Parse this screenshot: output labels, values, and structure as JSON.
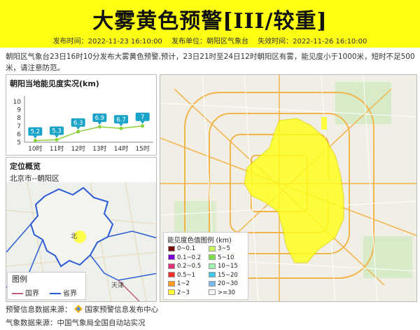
{
  "header": {
    "title": "大雾黄色预警[III/较重]",
    "publish_time_label": "发布时间：2022-11-23 16:10:00",
    "publisher_label": "发布单位：朝阳区气象台",
    "expiry_label": "失效时间：2022-11-26 16:10:00",
    "bg_color": "#ffff14"
  },
  "description": "朝阳区气象台23日16时10分发布大雾黄色预警,预计，23日21时至24日12时朝阳区有雾，能见度小于1000米，短时不足500米，请注意防范。",
  "visibility_panel": {
    "title": "朝阳当地能见度实况(km)",
    "chart_data": {
      "type": "line",
      "categories": [
        "10时",
        "11时",
        "12时",
        "13时",
        "14时",
        "15时"
      ],
      "values": [
        5.2,
        5.3,
        6.3,
        6.9,
        6.7,
        7
      ],
      "yticks": [
        "10",
        "9",
        "8",
        "7",
        "6",
        "5"
      ],
      "ylim": [
        5,
        10
      ],
      "line_color": "#8ed03a",
      "label_color": "#1aa3c8"
    }
  },
  "location_panel": {
    "title": "定位概览",
    "subtitle": "北京市--朝阳区",
    "legend_title": "图例",
    "legend_items": [
      {
        "label": "国界",
        "color": "#c0607a"
      },
      {
        "label": "省界",
        "color": "#2b5cd6"
      }
    ],
    "map_labels": {
      "beijing": "北",
      "tianjin": "天津"
    }
  },
  "visibility_map_legend": {
    "title": "能见度色值图例 (km)",
    "items": [
      {
        "label": "0~0.1",
        "color": "#7a0b0b"
      },
      {
        "label": "3~5",
        "color": "#c8f560"
      },
      {
        "label": "0.1~0.2",
        "color": "#7a00d6"
      },
      {
        "label": "5~10",
        "color": "#7de04a"
      },
      {
        "label": "0.2~0.5",
        "color": "#e0307a"
      },
      {
        "label": "10~15",
        "color": "#9df2ae"
      },
      {
        "label": "0.5~1",
        "color": "#ff2a2a"
      },
      {
        "label": "15~20",
        "color": "#3ec8e6"
      },
      {
        "label": "1~2",
        "color": "#ff9a1a"
      },
      {
        "label": "20~30",
        "color": "#7ab8ee"
      },
      {
        "label": "2~3",
        "color": "#ffff30"
      },
      {
        "label": ">=30",
        "color": "#f4f4f4"
      }
    ]
  },
  "footer": {
    "warning_source": "预警信息数据来源：",
    "warning_source_name": "国家预警信息发布中心",
    "weather_source": "气象数据来源：中国气象局全国自动站实况"
  }
}
